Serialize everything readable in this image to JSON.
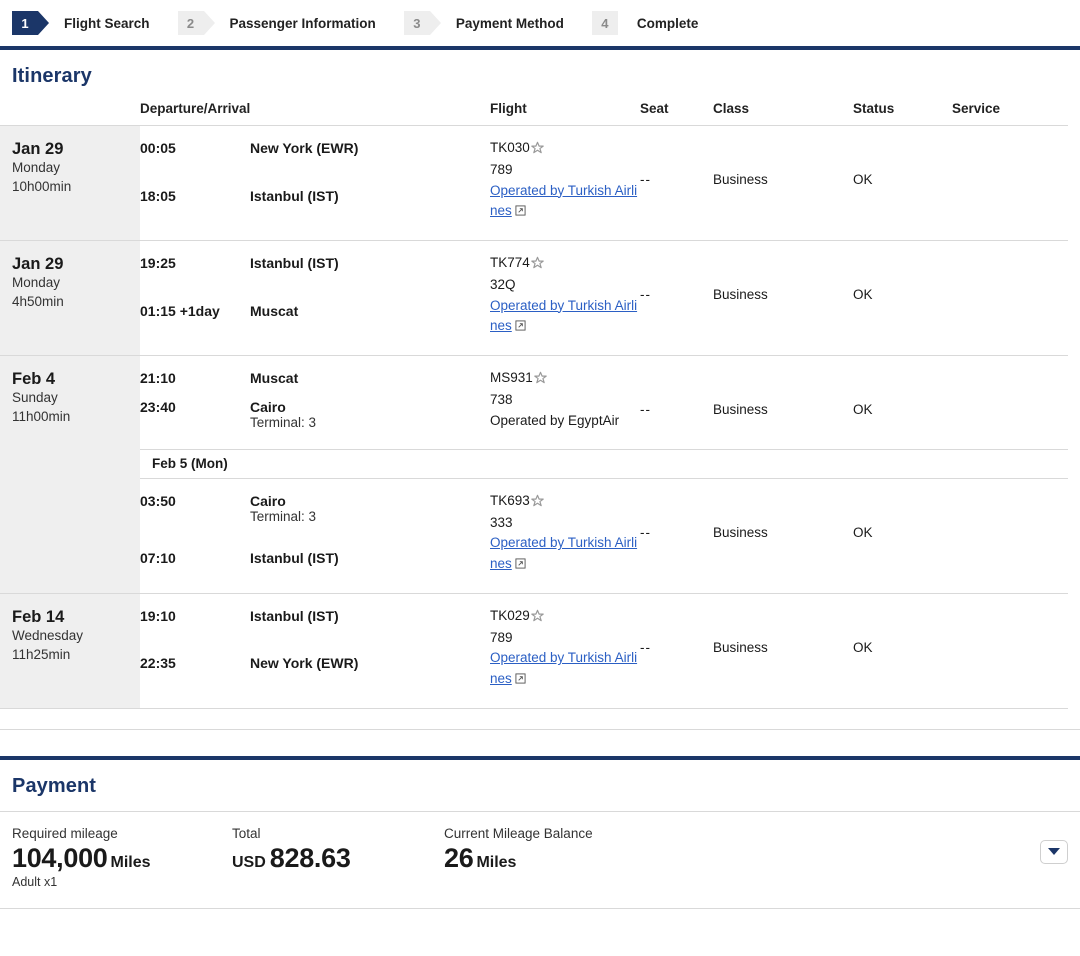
{
  "steps": [
    {
      "num": "1",
      "label": "Flight Search",
      "state": "active",
      "shape": "arrow"
    },
    {
      "num": "2",
      "label": "Passenger Information",
      "state": "inactive",
      "shape": "arrow"
    },
    {
      "num": "3",
      "label": "Payment Method",
      "state": "inactive",
      "shape": "arrow"
    },
    {
      "num": "4",
      "label": "Complete",
      "state": "inactive",
      "shape": "flat"
    }
  ],
  "itinerary": {
    "title": "Itinerary",
    "columns": {
      "date": "",
      "departure_arrival": "Departure/Arrival",
      "flight": "Flight",
      "seat": "Seat",
      "class": "Class",
      "status": "Status",
      "service": "Service"
    },
    "groups": [
      {
        "date_main": "Jan 29",
        "date_weekday": "Monday",
        "duration": "10h00min",
        "segments": [
          {
            "dep_time": "00:05",
            "dep_plus": "",
            "dep_place": "New York (EWR)",
            "dep_terminal": "",
            "arr_time": "18:05",
            "arr_plus": "",
            "arr_place": "Istanbul (IST)",
            "arr_terminal": "",
            "flight_no": "TK030",
            "star": true,
            "equipment": "789",
            "operated_by": "Operated by Turkish Airlines",
            "operated_is_link": true,
            "seat": "--",
            "class": "Business",
            "status": "OK",
            "service": ""
          }
        ]
      },
      {
        "date_main": "Jan 29",
        "date_weekday": "Monday",
        "duration": "4h50min",
        "segments": [
          {
            "dep_time": "19:25",
            "dep_plus": "",
            "dep_place": "Istanbul (IST)",
            "dep_terminal": "",
            "arr_time": "01:15",
            "arr_plus": "+1day",
            "arr_place": "Muscat",
            "arr_terminal": "",
            "flight_no": "TK774",
            "star": true,
            "equipment": "32Q",
            "operated_by": "Operated by Turkish Airlines",
            "operated_is_link": true,
            "seat": "--",
            "class": "Business",
            "status": "OK",
            "service": ""
          }
        ]
      },
      {
        "date_main": "Feb 4",
        "date_weekday": "Sunday",
        "duration": "11h00min",
        "segments": [
          {
            "dep_time": "21:10",
            "dep_plus": "",
            "dep_place": "Muscat",
            "dep_terminal": "",
            "arr_time": "23:40",
            "arr_plus": "",
            "arr_place": "Cairo",
            "arr_terminal": "Terminal: 3",
            "flight_no": "MS931",
            "star": true,
            "equipment": "738",
            "operated_by": "Operated by EgyptAir",
            "operated_is_link": false,
            "seat": "--",
            "class": "Business",
            "status": "OK",
            "service": ""
          },
          {
            "day_divider": "Feb 5 (Mon)",
            "dep_time": "03:50",
            "dep_plus": "",
            "dep_place": "Cairo",
            "dep_terminal": "Terminal: 3",
            "arr_time": "07:10",
            "arr_plus": "",
            "arr_place": "Istanbul (IST)",
            "arr_terminal": "",
            "flight_no": "TK693",
            "star": true,
            "equipment": "333",
            "operated_by": "Operated by Turkish Airlines",
            "operated_is_link": true,
            "seat": "--",
            "class": "Business",
            "status": "OK",
            "service": ""
          }
        ]
      },
      {
        "date_main": "Feb 14",
        "date_weekday": "Wednesday",
        "duration": "11h25min",
        "segments": [
          {
            "dep_time": "19:10",
            "dep_plus": "",
            "dep_place": "Istanbul (IST)",
            "dep_terminal": "",
            "arr_time": "22:35",
            "arr_plus": "",
            "arr_place": "New York (EWR)",
            "arr_terminal": "",
            "flight_no": "TK029",
            "star": true,
            "equipment": "789",
            "operated_by": "Operated by Turkish Airlines",
            "operated_is_link": true,
            "seat": "--",
            "class": "Business",
            "status": "OK",
            "service": ""
          }
        ]
      }
    ]
  },
  "payment": {
    "title": "Payment",
    "required_mileage_label": "Required mileage",
    "required_mileage_value": "104,000",
    "required_mileage_unit": "Miles",
    "required_mileage_note": "Adult x1",
    "total_label": "Total",
    "total_currency": "USD",
    "total_value": "828.63",
    "balance_label": "Current Mileage Balance",
    "balance_value": "26",
    "balance_unit": "Miles",
    "expand_icon": "chevron-down-icon"
  },
  "colors": {
    "navy": "#1b3668",
    "link": "#2b5fc4",
    "date_bg": "#efefef",
    "rule": "#d9d9d9"
  }
}
